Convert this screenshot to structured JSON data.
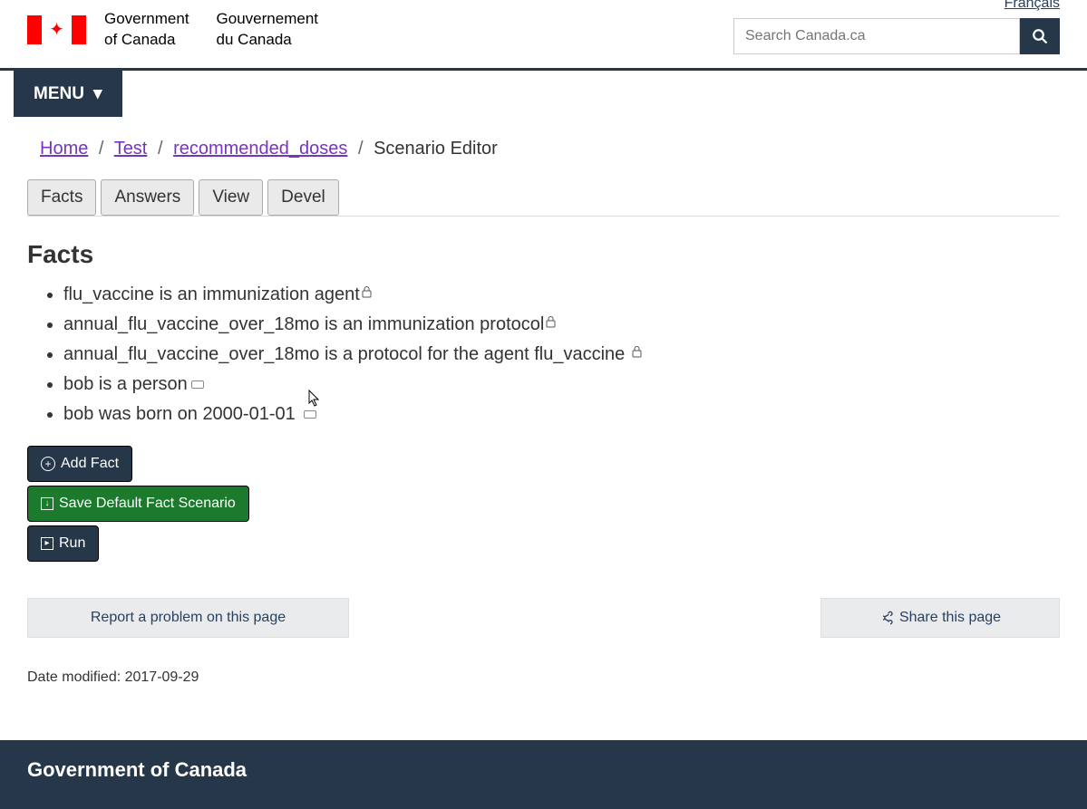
{
  "header": {
    "lang_link": "Français",
    "gov_en_1": "Government",
    "gov_en_2": "of Canada",
    "gov_fr_1": "Gouvernement",
    "gov_fr_2": "du Canada",
    "search_placeholder": "Search Canada.ca",
    "menu_label": "MENU"
  },
  "breadcrumbs": {
    "items": [
      "Home",
      "Test",
      "recommended_doses"
    ],
    "current": "Scenario Editor"
  },
  "tabs": [
    "Facts",
    "Answers",
    "View",
    "Devel"
  ],
  "section_heading": "Facts",
  "facts": [
    {
      "text": "flu_vaccine is an immunization agent",
      "locked": true,
      "note": false
    },
    {
      "text": "annual_flu_vaccine_over_18mo is an immunization protocol",
      "locked": true,
      "note": false
    },
    {
      "text": "annual_flu_vaccine_over_18mo is a protocol for the agent flu_vaccine ",
      "locked": true,
      "note": false
    },
    {
      "text": "bob is a person",
      "locked": false,
      "note": true
    },
    {
      "text": "bob was born on 2000-01-01 ",
      "locked": false,
      "note": true
    }
  ],
  "buttons": {
    "add_fact": "Add Fact",
    "save": "Save Default Fact Scenario",
    "run": "Run"
  },
  "footer_links": {
    "report": "Report a problem on this page",
    "share": "Share this page"
  },
  "date_modified_label": "Date modified: ",
  "date_modified_value": "2017-09-29",
  "footer_title": "Government of Canada"
}
